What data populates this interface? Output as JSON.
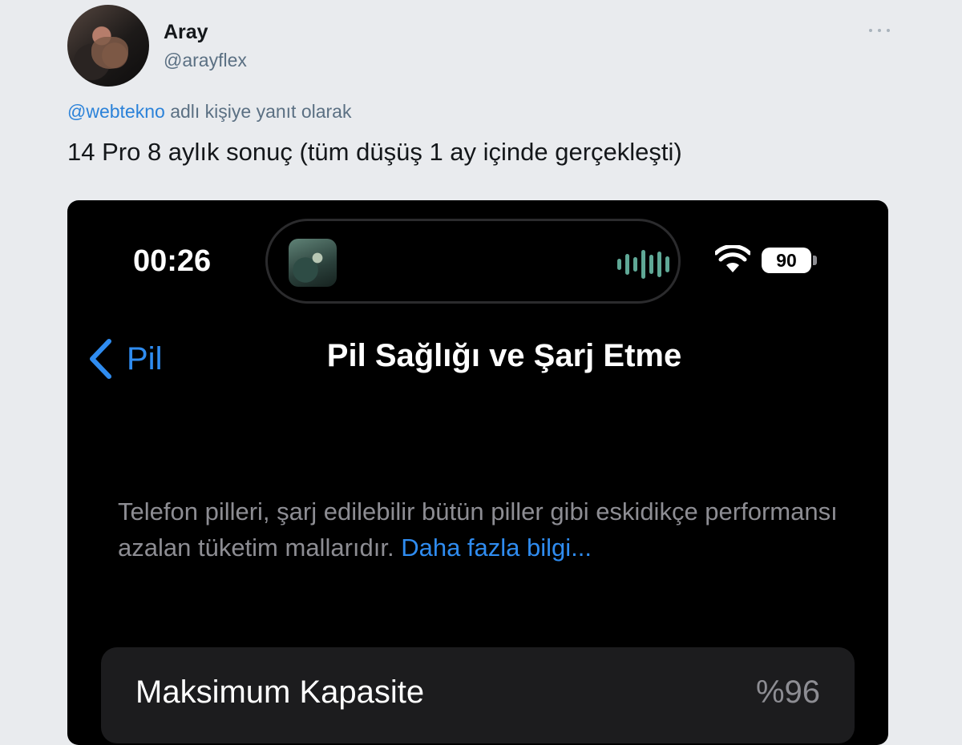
{
  "tweet": {
    "display_name": "Aray",
    "handle": "@arayflex",
    "reply_to_mention": "@webtekno",
    "reply_to_suffix": " adlı kişiye yanıt olarak",
    "text": "14 Pro 8 aylık sonuç (tüm düşüş 1 ay içinde gerçekleşti)",
    "more_icon": "ellipsis-icon"
  },
  "phone": {
    "status_bar": {
      "time": "00:26",
      "battery_level": "90",
      "wifi_icon": "wifi-icon"
    },
    "nav": {
      "back_label": "Pil",
      "title": "Pil Sağlığı ve Şarj Etme"
    },
    "info": {
      "text": "Telefon pilleri, şarj edilebilir bütün piller gibi eskidikçe performansı azalan tüketim mallarıdır. ",
      "link": "Daha fazla bilgi..."
    },
    "max_capacity": {
      "label": "Maksimum Kapasite",
      "value": "%96"
    }
  },
  "colors": {
    "page_background": "#e9ebee",
    "ios_blue": "#2f8cf0",
    "twitter_blue": "#2b82d9",
    "secondary_gray": "#8d8d93",
    "cell_background": "#1c1c1e"
  }
}
